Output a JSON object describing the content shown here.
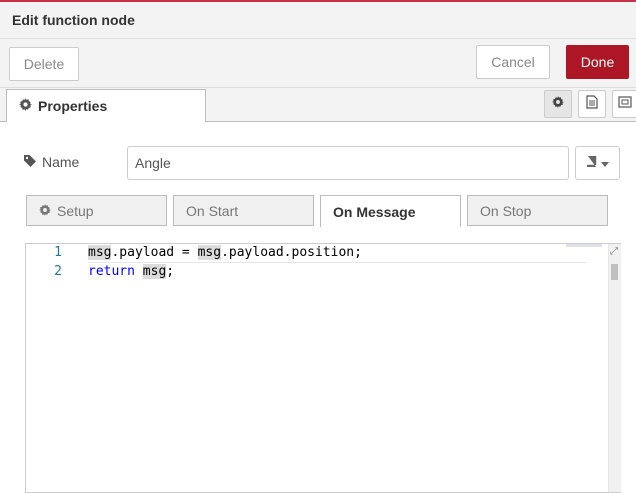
{
  "dialog": {
    "title": "Edit function node"
  },
  "toolbar": {
    "delete_label": "Delete",
    "cancel_label": "Cancel",
    "done_label": "Done"
  },
  "tabs": {
    "properties_label": "Properties",
    "icons": [
      "gear-icon",
      "description-icon",
      "appearance-icon"
    ]
  },
  "name_field": {
    "label": "Name",
    "value": "Angle"
  },
  "subtabs": {
    "setup": "Setup",
    "on_start": "On Start",
    "on_message": "On Message",
    "on_stop": "On Stop",
    "active": "On Message"
  },
  "editor": {
    "lines": [
      {
        "number": "1",
        "text": "msg.payload = msg.payload.position;"
      },
      {
        "number": "2",
        "text": "return msg;"
      }
    ]
  },
  "colors": {
    "accent": "#c9314a",
    "done_button": "#ad1625",
    "keyword": "#0000ff",
    "line_number": "#237893"
  }
}
